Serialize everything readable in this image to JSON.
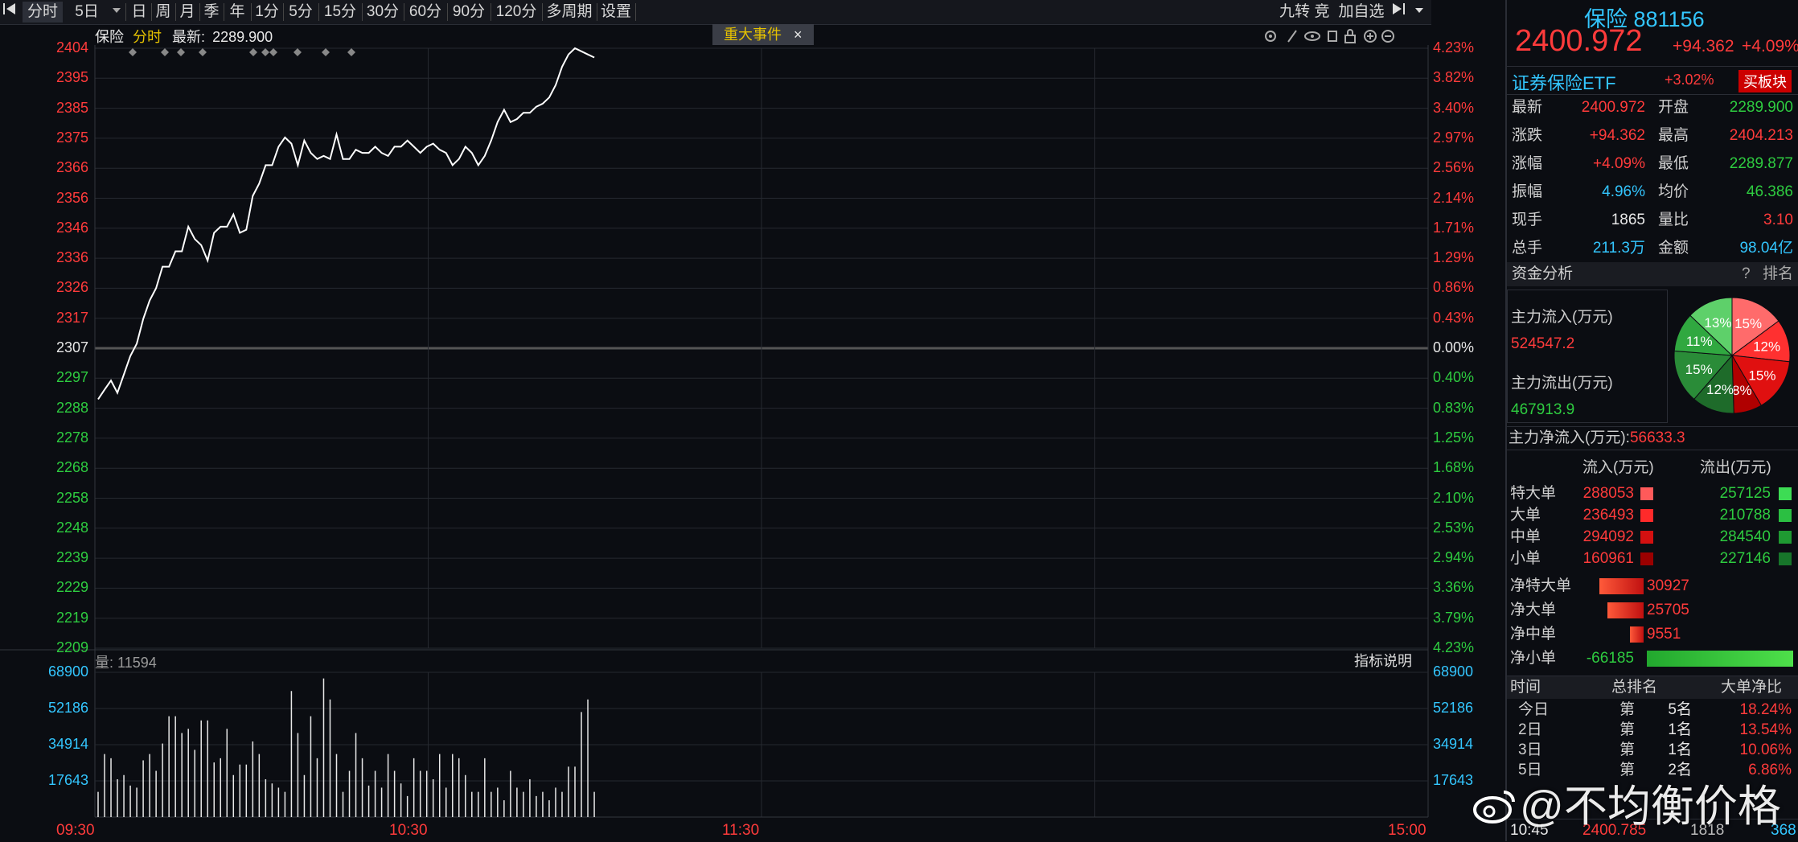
{
  "toolbar": {
    "period_buttons": [
      "分时",
      "5日",
      "日",
      "周",
      "月",
      "季",
      "年",
      "1分",
      "5分",
      "15分",
      "30分",
      "60分",
      "90分",
      "120分",
      "多周期",
      "设置"
    ],
    "right_items": [
      "九转",
      "竞",
      "加自选"
    ]
  },
  "chart_header": {
    "name": "保险",
    "mode": "分时",
    "latest_label": "最新:",
    "latest_value": "2289.900",
    "event_button": "重大事件",
    "event_close": "×"
  },
  "price_axis_left": [
    "2404",
    "2395",
    "2385",
    "2375",
    "2366",
    "2356",
    "2346",
    "2336",
    "2326",
    "2317",
    "2307",
    "2297",
    "2288",
    "2278",
    "2268",
    "2258",
    "2248",
    "2239",
    "2229",
    "2219",
    "2209"
  ],
  "price_axis_right": [
    "4.23%",
    "3.82%",
    "3.40%",
    "2.97%",
    "2.56%",
    "2.14%",
    "1.71%",
    "1.29%",
    "0.86%",
    "0.43%",
    "0.00%",
    "0.40%",
    "0.83%",
    "1.25%",
    "1.68%",
    "2.10%",
    "2.53%",
    "2.94%",
    "3.36%",
    "3.79%",
    "4.23%"
  ],
  "volume_header": {
    "label": "量:",
    "value": "11594",
    "help_button": "指标说明"
  },
  "volume_axis": [
    "68900",
    "52186",
    "34914",
    "17643"
  ],
  "time_axis": [
    "09:30",
    "10:30",
    "11:30",
    "15:00"
  ],
  "colors": {
    "up": "#ff3b3b",
    "down": "#2ecc40",
    "flat": "#e8e8e8",
    "bg": "#0b0d12",
    "grid": "#2a2d35"
  },
  "chart_data": {
    "type": "line",
    "open_price": 2307,
    "ylim": [
      2209,
      2404
    ],
    "x_total_minutes": 240,
    "price_series": [
      2289.9,
      2293,
      2296,
      2292,
      2298,
      2304,
      2308,
      2316,
      2322,
      2326,
      2333,
      2333,
      2338,
      2338,
      2346,
      2342,
      2340,
      2335,
      2344,
      2346,
      2346,
      2350,
      2344,
      2345,
      2356,
      2360,
      2366,
      2366,
      2372,
      2375,
      2373,
      2366,
      2374,
      2370,
      2368,
      2369,
      2368,
      2376,
      2368,
      2368,
      2371,
      2370,
      2370,
      2372,
      2370,
      2369,
      2372,
      2372,
      2374,
      2372,
      2370,
      2372,
      2373,
      2371,
      2370,
      2366,
      2368,
      2372,
      2370,
      2366,
      2369,
      2374,
      2380,
      2384,
      2380,
      2381,
      2383,
      2383,
      2385,
      2386,
      2388,
      2392,
      2398,
      2402,
      2404,
      2403,
      2402,
      2401
    ],
    "volume_series": [
      12000,
      30000,
      28000,
      18000,
      20000,
      15000,
      14000,
      27000,
      30000,
      22000,
      35000,
      48000,
      48000,
      40000,
      42000,
      32000,
      46000,
      46000,
      26000,
      28000,
      42000,
      20000,
      25000,
      25000,
      36000,
      30000,
      18000,
      16000,
      14000,
      12000,
      60000,
      40000,
      20000,
      48000,
      28000,
      66000,
      56000,
      30000,
      12000,
      22000,
      40000,
      28000,
      15000,
      22000,
      14000,
      30000,
      22000,
      16000,
      10000,
      28000,
      22000,
      22000,
      18000,
      30000,
      14000,
      30000,
      28000,
      20000,
      12000,
      12000,
      28000,
      12000,
      14000,
      8000,
      22000,
      14000,
      12000,
      18000,
      10000,
      12000,
      8000,
      14000,
      12000,
      24000,
      24000,
      50000,
      56000,
      12000
    ]
  },
  "quote": {
    "name": "保险",
    "code": "881156",
    "price": "2400.972",
    "change": "+94.362",
    "change_pct": "+4.09%",
    "related_etf": "证券保险ETF",
    "related_etf_change": "+3.02%",
    "buy_board_button": "买板块",
    "stats": [
      {
        "l1": "最新",
        "v1": "2400.972",
        "c1": "red",
        "l2": "开盘",
        "v2": "2289.900",
        "c2": "green"
      },
      {
        "l1": "涨跌",
        "v1": "+94.362",
        "c1": "red",
        "l2": "最高",
        "v2": "2404.213",
        "c2": "red"
      },
      {
        "l1": "涨幅",
        "v1": "+4.09%",
        "c1": "red",
        "l2": "最低",
        "v2": "2289.877",
        "c2": "green"
      },
      {
        "l1": "振幅",
        "v1": "4.96%",
        "c1": "cyan",
        "l2": "均价",
        "v2": "46.386",
        "c2": "green"
      },
      {
        "l1": "现手",
        "v1": "1865",
        "c1": "white",
        "l2": "量比",
        "v2": "3.10",
        "c2": "red"
      },
      {
        "l1": "总手",
        "v1": "211.3万",
        "c1": "cyan",
        "l2": "金额",
        "v2": "98.04亿",
        "c2": "cyan"
      }
    ]
  },
  "fund_analysis": {
    "title": "资金分析",
    "help": "?",
    "rank": "排名",
    "inflow_label": "主力流入(万元)",
    "inflow_value": "524547.2",
    "outflow_label": "主力流出(万元)",
    "outflow_value": "467913.9",
    "net_label": "主力净流入(万元):",
    "net_value": "56633.3",
    "pie": [
      {
        "label": "15%",
        "value": 15,
        "color": "#ff6b6b"
      },
      {
        "label": "12%",
        "value": 12,
        "color": "#ff3030"
      },
      {
        "label": "15%",
        "value": 15,
        "color": "#e01010"
      },
      {
        "label": "8%",
        "value": 8,
        "color": "#b00000"
      },
      {
        "label": "12%",
        "value": 12,
        "color": "#1e6b2a"
      },
      {
        "label": "15%",
        "value": 15,
        "color": "#2a8c38"
      },
      {
        "label": "11%",
        "value": 11,
        "color": "#30a840"
      },
      {
        "label": "13%",
        "value": 13,
        "color": "#5ed06a"
      }
    ]
  },
  "flow_table": {
    "headers": [
      "流入(万元)",
      "流出(万元)"
    ],
    "rows": [
      {
        "name": "特大单",
        "in": "288053",
        "out": "257125",
        "in_color": "#ff5a5a",
        "out_color": "#3ddc54"
      },
      {
        "name": "大单",
        "in": "236493",
        "out": "210788",
        "in_color": "#ff2a2a",
        "out_color": "#2bbf42"
      },
      {
        "name": "中单",
        "in": "294092",
        "out": "284540",
        "in_color": "#d41010",
        "out_color": "#1f9a32"
      },
      {
        "name": "小单",
        "in": "160961",
        "out": "227146",
        "in_color": "#9a0000",
        "out_color": "#17752a"
      }
    ]
  },
  "net_flows": [
    {
      "name": "净特大单",
      "value": "30927",
      "amount": 30927
    },
    {
      "name": "净大单",
      "value": "25705",
      "amount": 25705
    },
    {
      "name": "净中单",
      "value": "9551",
      "amount": 9551
    },
    {
      "name": "净小单",
      "value": "-66185",
      "amount": -66185
    }
  ],
  "rank_table": {
    "headers": [
      "时间",
      "总排名",
      "大单净比"
    ],
    "rows": [
      {
        "period": "今日",
        "prefix": "第",
        "rank": "5名",
        "ratio": "18.24%"
      },
      {
        "period": "2日",
        "prefix": "第",
        "rank": "1名",
        "ratio": "13.54%"
      },
      {
        "period": "3日",
        "prefix": "第",
        "rank": "1名",
        "ratio": "10.06%"
      },
      {
        "period": "5日",
        "prefix": "第",
        "rank": "2名",
        "ratio": "6.86%"
      }
    ]
  },
  "tick": {
    "time": "10:45",
    "price": "2400.785",
    "vol": "1818",
    "extra": "368"
  },
  "watermark": "@不均衡价格"
}
